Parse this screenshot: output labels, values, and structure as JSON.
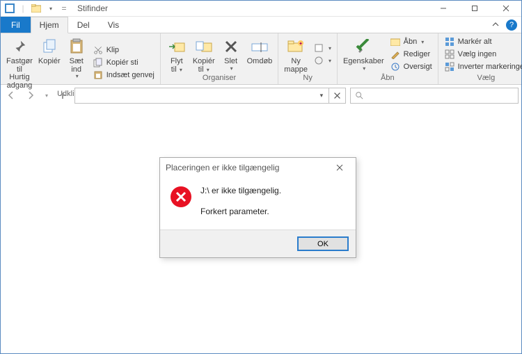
{
  "titlebar": {
    "title": "Stifinder"
  },
  "tabs": {
    "file": "Fil",
    "home": "Hjem",
    "share": "Del",
    "view": "Vis"
  },
  "ribbon": {
    "clipboard": {
      "label": "Udklipsholder",
      "pin": "Fastgør til",
      "pin2": "Hurtig adgang",
      "copy": "Kopiér",
      "paste": "Sæt",
      "paste2": "ind",
      "cut": "Klip",
      "copypath": "Kopiér sti",
      "pasteshortcut": "Indsæt genvej"
    },
    "organize": {
      "label": "Organiser",
      "moveto": "Flyt",
      "moveto2": "til",
      "copyto": "Kopiér",
      "copyto2": "til",
      "delete": "Slet",
      "rename": "Omdøb"
    },
    "new": {
      "label": "Ny",
      "newfolder": "Ny",
      "newfolder2": "mappe"
    },
    "open": {
      "label": "Åbn",
      "properties": "Egenskaber",
      "open": "Åbn",
      "edit": "Rediger",
      "history": "Oversigt"
    },
    "select": {
      "label": "Vælg",
      "selectall": "Markér alt",
      "selectnone": "Vælg ingen",
      "invert": "Inverter markeringen"
    }
  },
  "dialog": {
    "title": "Placeringen er ikke tilgængelig",
    "line1": "J:\\ er ikke tilgængelig.",
    "line2": "Forkert parameter.",
    "ok": "OK"
  }
}
